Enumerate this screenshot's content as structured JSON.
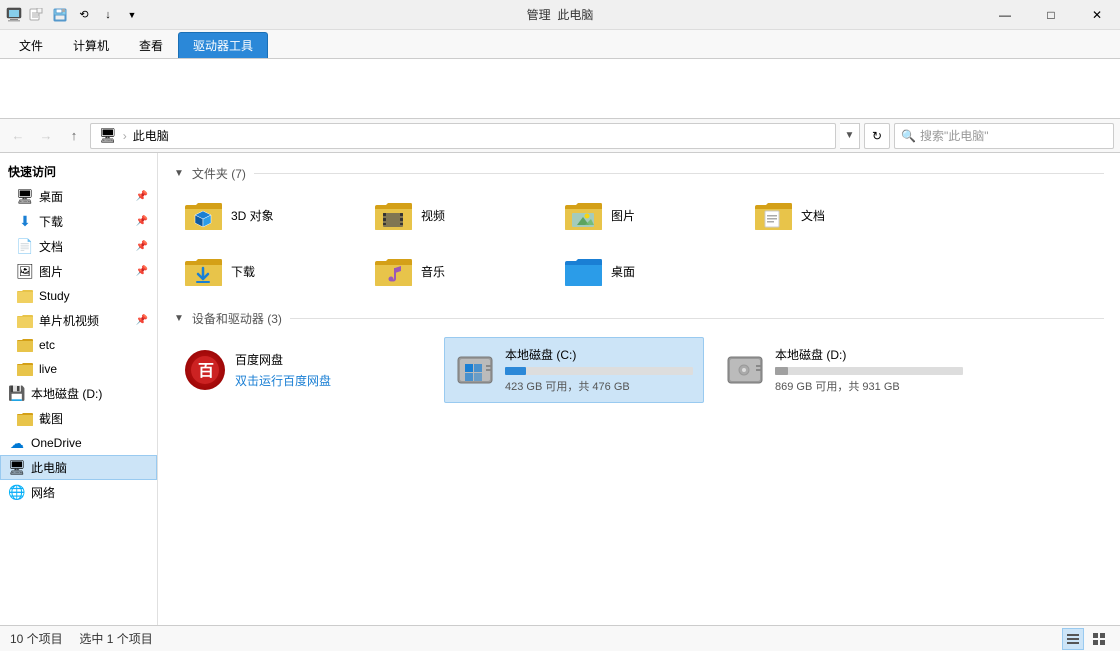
{
  "titlebar": {
    "title": "此电脑",
    "ribbon_tabs_label": "管理",
    "this_pc_label": "此电脑",
    "min_label": "—",
    "max_label": "□",
    "close_label": "✕",
    "help_label": "?"
  },
  "ribbon": {
    "tabs": [
      {
        "id": "file",
        "label": "文件"
      },
      {
        "id": "computer",
        "label": "计算机"
      },
      {
        "id": "view",
        "label": "查看"
      },
      {
        "id": "manage",
        "label": "驱动器工具"
      }
    ],
    "active_tab": "manage"
  },
  "address": {
    "back_label": "←",
    "forward_label": "→",
    "up_label": "↑",
    "path_icon": "🖥",
    "path_separator": " › ",
    "path_text": "此电脑",
    "refresh_label": "↻",
    "search_placeholder": "搜索\"此电脑\""
  },
  "sidebar": {
    "quick_access": "快速访问",
    "items": [
      {
        "id": "desktop",
        "label": "桌面",
        "icon": "🖥",
        "pinned": true
      },
      {
        "id": "downloads",
        "label": "下载",
        "icon": "⬇",
        "pinned": true
      },
      {
        "id": "documents",
        "label": "文档",
        "icon": "📄",
        "pinned": true
      },
      {
        "id": "pictures",
        "label": "图片",
        "icon": "🖼",
        "pinned": true
      },
      {
        "id": "study",
        "label": "Study",
        "pinned": false
      },
      {
        "id": "single-video",
        "label": "单片机视频",
        "pinned": true
      },
      {
        "id": "etc",
        "label": "etc",
        "pinned": false
      },
      {
        "id": "live",
        "label": "live",
        "pinned": false
      }
    ],
    "drives": [
      {
        "id": "local-d",
        "label": "本地磁盘 (D:)"
      }
    ],
    "cut": [
      {
        "id": "screenshot",
        "label": "截图"
      }
    ],
    "onedrive": "OneDrive",
    "this_pc": "此电脑",
    "network": "网络"
  },
  "content": {
    "folders_section_label": "文件夹 (7)",
    "drives_section_label": "设备和驱动器 (3)",
    "folders": [
      {
        "id": "3d-objects",
        "label": "3D 对象",
        "type": "3d"
      },
      {
        "id": "videos",
        "label": "视频",
        "type": "video"
      },
      {
        "id": "pictures",
        "label": "图片",
        "type": "pictures"
      },
      {
        "id": "documents",
        "label": "文档",
        "type": "documents"
      },
      {
        "id": "downloads",
        "label": "下载",
        "type": "downloads"
      },
      {
        "id": "music",
        "label": "音乐",
        "type": "music"
      },
      {
        "id": "desktop",
        "label": "桌面",
        "type": "desktop"
      }
    ],
    "drives": [
      {
        "id": "baidu",
        "label": "百度网盘",
        "sublabel": "双击运行百度网盘",
        "type": "baidu",
        "selected": false
      },
      {
        "id": "c-drive",
        "label": "本地磁盘 (C:)",
        "type": "local",
        "free": "423 GB 可用，共 476 GB",
        "free_gb": 423,
        "total_gb": 476,
        "selected": true,
        "bar_color": "#2b88d8"
      },
      {
        "id": "d-drive",
        "label": "本地磁盘 (D:)",
        "type": "local",
        "free": "869 GB 可用，共 931 GB",
        "free_gb": 869,
        "total_gb": 931,
        "selected": false,
        "bar_color": "#a0a0a0"
      }
    ]
  },
  "statusbar": {
    "items_count": "10 个项目",
    "selected_count": "选中 1 个项目"
  }
}
